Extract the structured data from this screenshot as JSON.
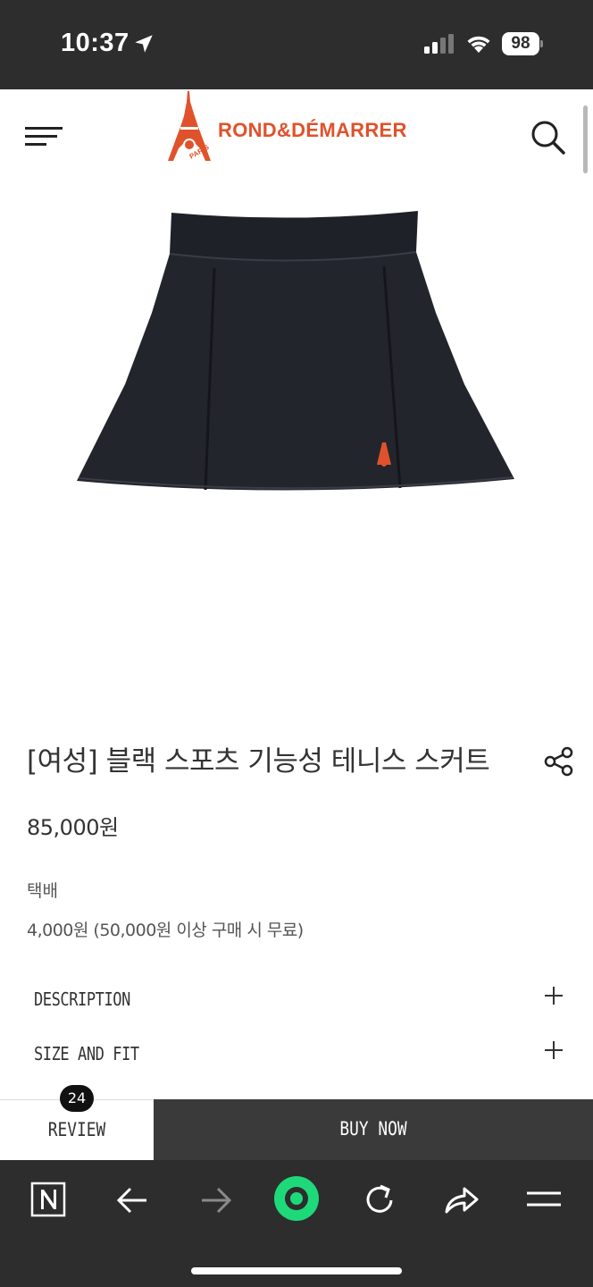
{
  "status_bar": {
    "time": "10:37",
    "battery": "98"
  },
  "header": {
    "logo_text": "ROND&DÉMARRER",
    "logo_subtext": "PARIS"
  },
  "product": {
    "title": "[여성] 블랙 스포츠 기능성 테니스 스커트",
    "price": "85,000원",
    "shipping_label": "택배",
    "shipping_info": "4,000원 (50,000원 이상 구매 시 무료)"
  },
  "accordion": {
    "items": [
      {
        "label": "DESCRIPTION"
      },
      {
        "label": "SIZE AND FIT"
      }
    ]
  },
  "bottom_bar": {
    "review_label": "REVIEW",
    "review_count": "24",
    "buy_label": "BUY NOW"
  },
  "colors": {
    "brand": "#e0522b",
    "accent_green": "#1ed97a",
    "dark": "#2d2d2d"
  },
  "icons": [
    "location-arrow-icon",
    "signal-icon",
    "wifi-icon",
    "menu-icon",
    "search-icon",
    "share-icon",
    "plus-icon",
    "naver-icon",
    "back-icon",
    "forward-icon",
    "green-dot-icon",
    "reload-icon",
    "share-arrow-icon",
    "hamburger-icon"
  ]
}
